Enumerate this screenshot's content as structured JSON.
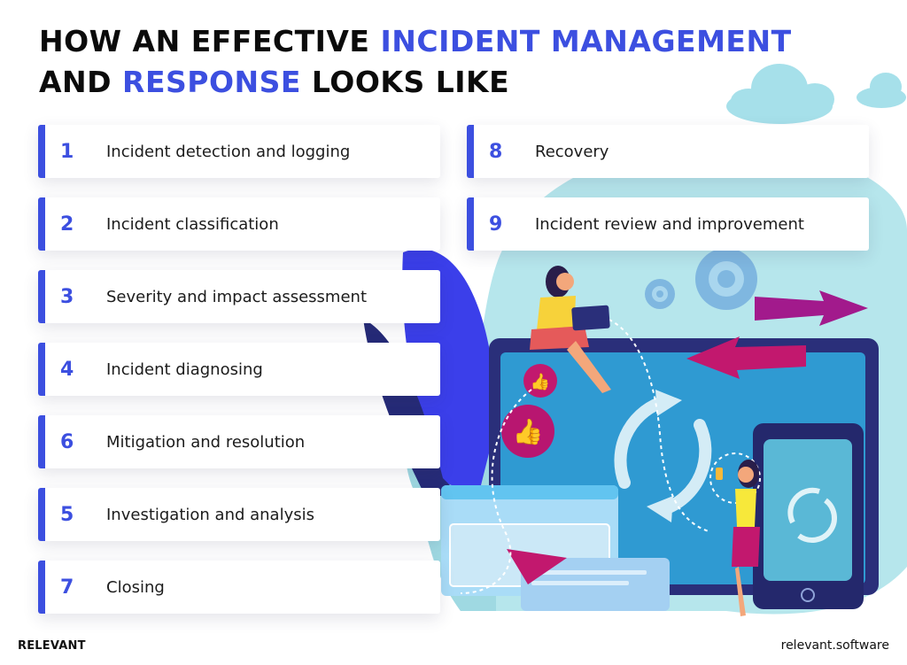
{
  "title": {
    "line1_plain": "HOW AN EFFECTIVE ",
    "line1_highlight": "INCIDENT MANAGEMENT",
    "line2_pre": "AND ",
    "line2_highlight": "RESPONSE",
    "line2_post": " LOOKS LIKE"
  },
  "colors": {
    "accent": "#3c4fe0",
    "text": "#1c1c1c",
    "illustration_teal": "#a8e2ea",
    "illustration_navy": "#2a2f7a",
    "illustration_magenta": "#c2186e"
  },
  "steps_left": [
    {
      "number": "1",
      "label": "Incident detection and logging"
    },
    {
      "number": "2",
      "label": "Incident classification"
    },
    {
      "number": "3",
      "label": "Severity and impact assessment"
    },
    {
      "number": "4",
      "label": "Incident diagnosing"
    },
    {
      "number": "6",
      "label": "Mitigation and resolution"
    },
    {
      "number": "5",
      "label": "Investigation and analysis"
    },
    {
      "number": "7",
      "label": "Closing"
    }
  ],
  "steps_right": [
    {
      "number": "8",
      "label": "Recovery"
    },
    {
      "number": "9",
      "label": "Incident review and improvement"
    }
  ],
  "illustration": {
    "icons": [
      "cloud-icon",
      "gear-icon",
      "arrow-right-icon",
      "arrow-left-icon",
      "monitor-icon",
      "refresh-icon",
      "thumbs-up-icon",
      "tablet-icon",
      "paper-plane-icon",
      "person-with-laptop",
      "person-with-phone"
    ]
  },
  "footer": {
    "brand": "RELEVANT",
    "website": "relevant.software"
  }
}
